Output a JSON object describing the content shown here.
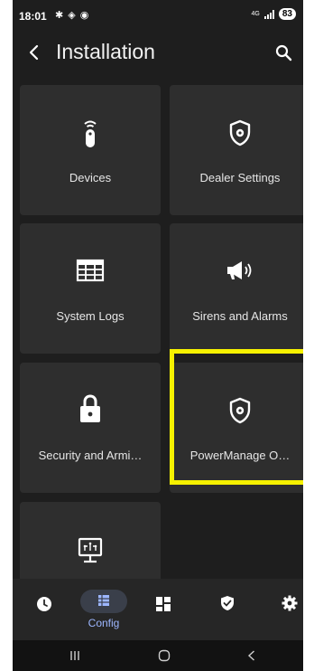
{
  "status_bar": {
    "time": "18:01",
    "icons": "✱ ◈ ◉",
    "network": "4G",
    "battery": "83"
  },
  "header": {
    "title": "Installation",
    "back_icon": "chevron-left-icon",
    "search_icon": "search-icon"
  },
  "tiles": [
    {
      "label": "Devices",
      "icon": "remote-icon"
    },
    {
      "label": "Dealer Settings",
      "icon": "shield-gear-icon"
    },
    {
      "label": "System Logs",
      "icon": "table-icon"
    },
    {
      "label": "Sirens and Alarms",
      "icon": "megaphone-icon"
    },
    {
      "label": "Security and Armi…",
      "icon": "lock-icon"
    },
    {
      "label": "PowerManage O…",
      "icon": "shield-gear-icon"
    },
    {
      "label": "",
      "icon": "monitor-network-icon"
    }
  ],
  "bottom_nav": {
    "items": [
      {
        "icon": "clock-icon",
        "label": ""
      },
      {
        "icon": "config-icon",
        "label": "Config"
      },
      {
        "icon": "dashboard-icon",
        "label": ""
      },
      {
        "icon": "shield-check-icon",
        "label": ""
      },
      {
        "icon": "gear-icon",
        "label": ""
      }
    ],
    "active_color": "#9db7ff"
  },
  "highlight_color": "#f6f100"
}
